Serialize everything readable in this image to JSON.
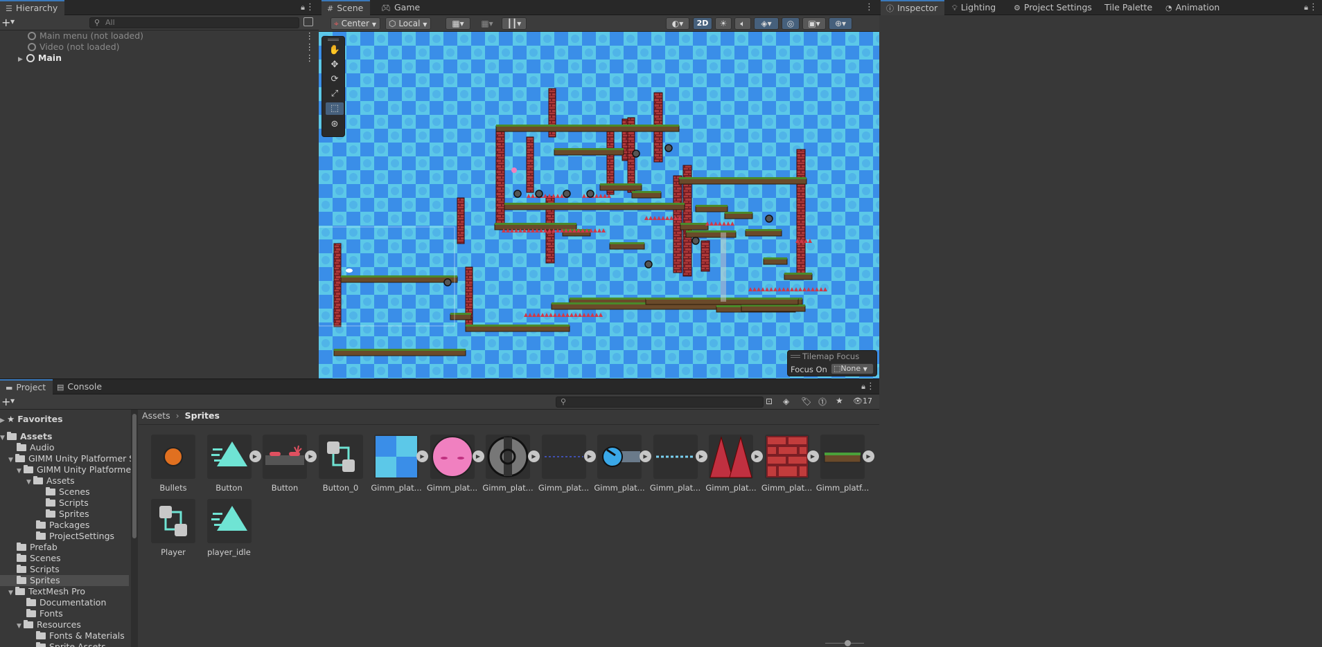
{
  "hierarchy": {
    "tab": "Hierarchy",
    "search_placeholder": "All",
    "items": [
      {
        "label": "Main menu (not loaded)"
      },
      {
        "label": "Video (not loaded)"
      },
      {
        "label": "Main"
      }
    ]
  },
  "scene": {
    "tabs": [
      "Scene",
      "Game"
    ],
    "pivot": "Center",
    "space": "Local",
    "mode_2d": "2D",
    "tilemap_focus_title": "Tilemap Focus",
    "focus_on_label": "Focus On",
    "focus_on_value": "None"
  },
  "right": {
    "tabs": [
      "Inspector",
      "Lighting",
      "Project Settings",
      "Tile Palette",
      "Animation"
    ]
  },
  "project": {
    "tabs": [
      "Project",
      "Console"
    ],
    "hidden_count": "17",
    "breadcrumb": [
      "Assets",
      "Sprites"
    ],
    "tree": [
      {
        "label": "Favorites"
      },
      {
        "label": "Assets"
      },
      {
        "label": "Audio"
      },
      {
        "label": "GIMM Unity Platformer St"
      },
      {
        "label": "GIMM Unity Platformer"
      },
      {
        "label": "Assets"
      },
      {
        "label": "Scenes"
      },
      {
        "label": "Scripts"
      },
      {
        "label": "Sprites"
      },
      {
        "label": "Packages"
      },
      {
        "label": "ProjectSettings"
      },
      {
        "label": "Prefab"
      },
      {
        "label": "Scenes"
      },
      {
        "label": "Scripts"
      },
      {
        "label": "Sprites"
      },
      {
        "label": "TextMesh Pro"
      },
      {
        "label": "Documentation"
      },
      {
        "label": "Fonts"
      },
      {
        "label": "Resources"
      },
      {
        "label": "Fonts & Materials"
      },
      {
        "label": "Sprite Assets"
      }
    ],
    "assets": [
      {
        "label": "Bullets",
        "icon": "orange-ball-icon"
      },
      {
        "label": "Button",
        "icon": "triangle-icon"
      },
      {
        "label": "Button",
        "icon": "button-sprite-icon"
      },
      {
        "label": "Button_0",
        "icon": "prefab-icon"
      },
      {
        "label": "Gimm_plat...",
        "icon": "blue-tile-icon"
      },
      {
        "label": "Gimm_plat...",
        "icon": "pink-blob-icon"
      },
      {
        "label": "Gimm_plat...",
        "icon": "saw-icon"
      },
      {
        "label": "Gimm_plat...",
        "icon": "dots-icon"
      },
      {
        "label": "Gimm_plat...",
        "icon": "cannon-icon"
      },
      {
        "label": "Gimm_plat...",
        "icon": "dashed-line-icon"
      },
      {
        "label": "Gimm_plat...",
        "icon": "spikes-icon"
      },
      {
        "label": "Gimm_plat...",
        "icon": "brick-icon"
      },
      {
        "label": "Gimm_platf...",
        "icon": "grass-platform-icon"
      },
      {
        "label": "Player",
        "icon": "prefab-icon"
      },
      {
        "label": "player_idle",
        "icon": "triangle-icon"
      }
    ]
  },
  "colors": {
    "accent": "#3a79bb",
    "panel": "#383838",
    "checker_light": "#5cc8e8",
    "checker_dark": "#3a8ee8",
    "brick": "#b03a3a",
    "grass": "#4a8a2a"
  }
}
